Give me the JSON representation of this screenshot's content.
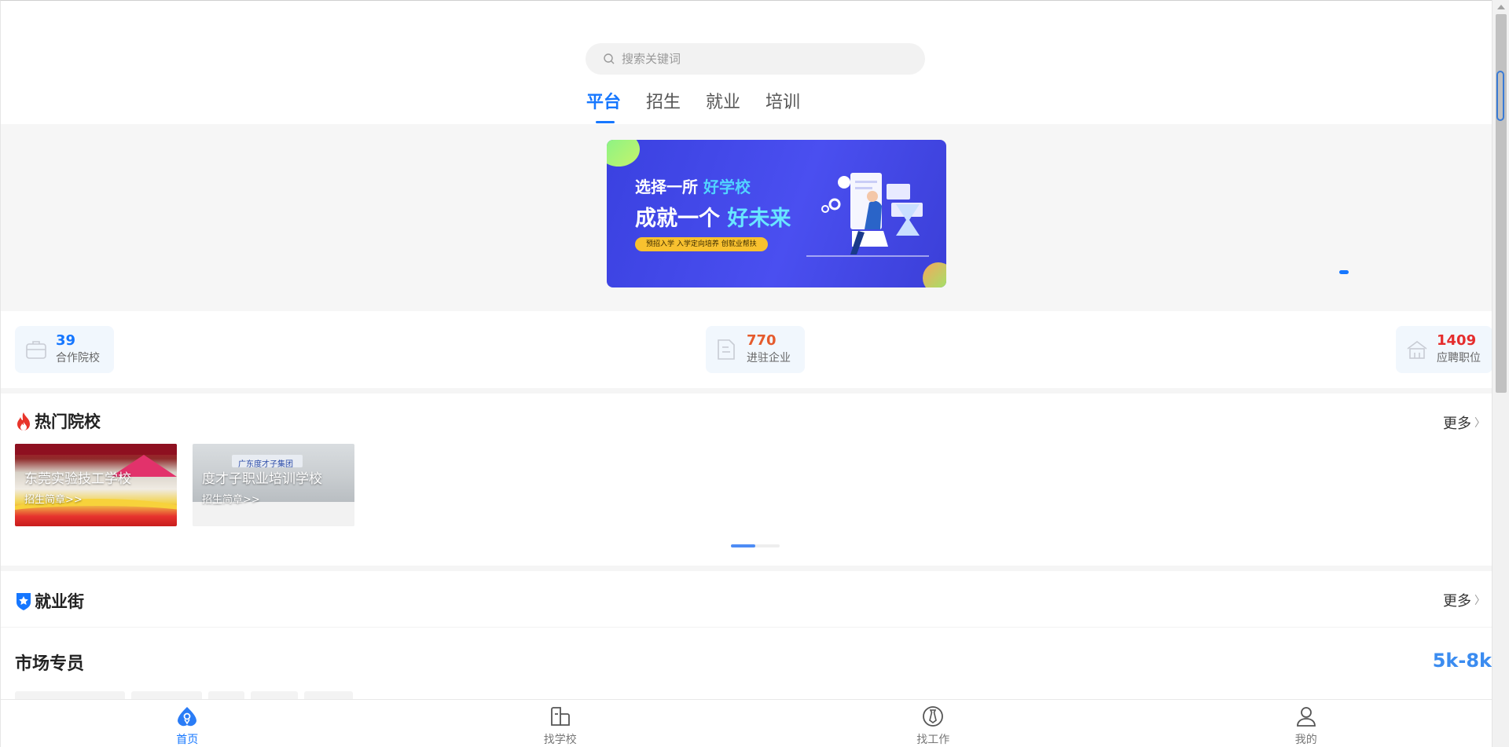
{
  "search": {
    "placeholder": "搜索关键词"
  },
  "tabs": [
    {
      "label": "平台",
      "active": true
    },
    {
      "label": "招生",
      "active": false
    },
    {
      "label": "就业",
      "active": false
    },
    {
      "label": "培训",
      "active": false
    }
  ],
  "banner": {
    "line1_prefix": "选择一所",
    "line1_highlight": "好学校",
    "line2_prefix": "成就一个",
    "line2_highlight": "好未来",
    "pill": "预招入学  入学定向培养  创就业帮扶"
  },
  "stats": [
    {
      "value": "39",
      "label": "合作院校",
      "icon": "briefcase-icon",
      "color": "#1677ff"
    },
    {
      "value": "770",
      "label": "进驻企业",
      "icon": "building-icon",
      "color": "#e55b2d"
    },
    {
      "value": "1409",
      "label": "应聘职位",
      "icon": "office-icon",
      "color": "#e52d2d"
    }
  ],
  "hot_schools": {
    "title": "热门院校",
    "more": "更多",
    "cards": [
      {
        "name": "东莞实验技工学校",
        "sub": "招生简章>>"
      },
      {
        "name": "度才子职业培训学校",
        "sub": "招生简章>>",
        "sign": "广东度才子集团"
      }
    ]
  },
  "jobs": {
    "title": "就业街",
    "more": "更多",
    "first_job": {
      "title": "市场专员",
      "salary": "5k-8k"
    }
  },
  "tabbar": [
    {
      "label": "首页",
      "icon": "home-icon",
      "active": true
    },
    {
      "label": "找学校",
      "icon": "school-icon",
      "active": false
    },
    {
      "label": "找工作",
      "icon": "tie-icon",
      "active": false
    },
    {
      "label": "我的",
      "icon": "user-icon",
      "active": false
    }
  ],
  "colors": {
    "accent": "#1677ff",
    "salary": "#3b8cf0"
  }
}
